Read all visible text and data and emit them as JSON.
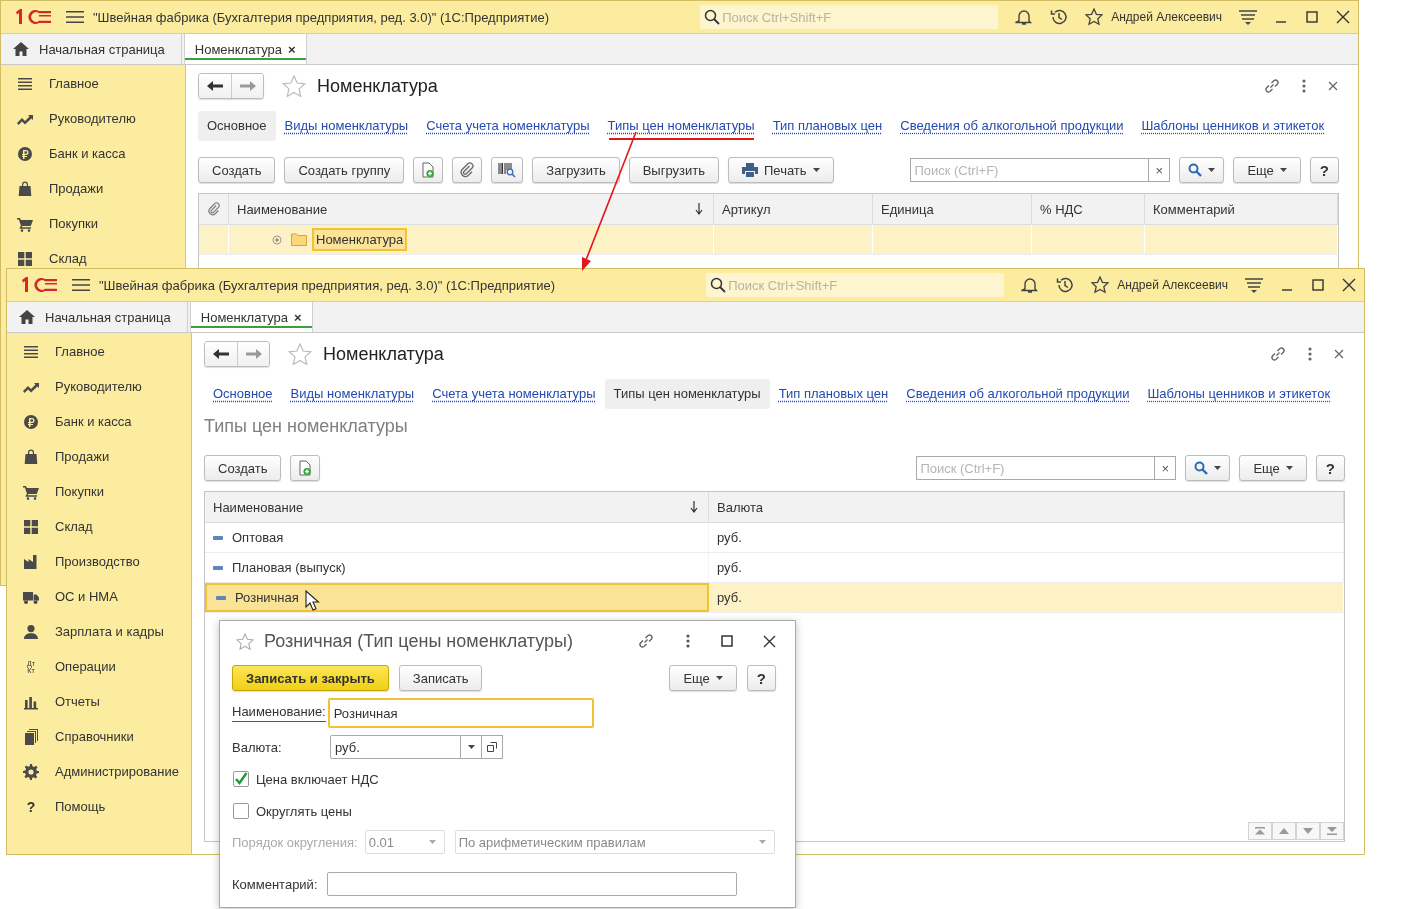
{
  "windows": [
    {
      "title": "\"Швейная фабрика (Бухгалтерия предприятия, ред. 3.0)\"  (1С:Предприятие)",
      "search_placeholder": "Поиск Ctrl+Shift+F",
      "user": "Андрей Алексеевич",
      "tabs": [
        {
          "label": "Начальная страница",
          "selected": false,
          "kind": "home"
        },
        {
          "label": "Номенклатура",
          "selected": true,
          "kind": "page",
          "close": "×"
        }
      ],
      "sidebar": [
        {
          "label": "Главное"
        },
        {
          "label": "Руководителю"
        },
        {
          "label": "Банк и касса"
        },
        {
          "label": "Продажи"
        },
        {
          "label": "Покупки"
        },
        {
          "label": "Склад"
        }
      ],
      "form": {
        "title": "Номенклатура",
        "sections": [
          {
            "label": "Основное",
            "selected": true,
            "annotated": false
          },
          {
            "label": "Виды номенклатуры",
            "selected": false,
            "annotated": false
          },
          {
            "label": "Счета учета номенклатуры",
            "selected": false,
            "annotated": false
          },
          {
            "label": "Типы цен номенклатуры",
            "selected": false,
            "annotated": true
          },
          {
            "label": "Тип плановых цен",
            "selected": false,
            "annotated": false
          },
          {
            "label": "Сведения об алкогольной продукции",
            "selected": false,
            "annotated": false
          },
          {
            "label": "Шаблоны ценников и этикеток",
            "selected": false,
            "annotated": false
          }
        ],
        "toolbar": [
          {
            "kind": "button",
            "label": "Создать"
          },
          {
            "kind": "button",
            "label": "Создать группу"
          },
          {
            "kind": "new"
          },
          {
            "kind": "attach"
          },
          {
            "kind": "barcode"
          },
          {
            "kind": "button",
            "label": "Загрузить"
          },
          {
            "kind": "button",
            "label": "Выгрузить"
          },
          {
            "kind": "print",
            "label": "Печать"
          }
        ],
        "search_placeholder": "Поиск (Ctrl+F)",
        "clear": "×",
        "more": "Еще",
        "help": "?",
        "table": {
          "attach_column": true,
          "columns": [
            {
              "label": "Наименование",
              "sorted": true
            },
            {
              "label": "Артикул",
              "sorted": false
            },
            {
              "label": "Единица",
              "sorted": false
            },
            {
              "label": "% НДС",
              "sorted": false
            },
            {
              "label": "Комментарий",
              "sorted": false
            }
          ],
          "rows": [
            {
              "kind": "folder",
              "selected": true,
              "cells": [
                "Номенклатура"
              ]
            }
          ]
        }
      }
    },
    {
      "title": "\"Швейная фабрика (Бухгалтерия предприятия, ред. 3.0)\"  (1С:Предприятие)",
      "search_placeholder": "Поиск Ctrl+Shift+F",
      "user": "Андрей Алексеевич",
      "tabs": [
        {
          "label": "Начальная страница",
          "selected": false,
          "kind": "home"
        },
        {
          "label": "Номенклатура",
          "selected": true,
          "kind": "page",
          "close": "×"
        }
      ],
      "sidebar": [
        {
          "label": "Главное"
        },
        {
          "label": "Руководителю"
        },
        {
          "label": "Банк и касса"
        },
        {
          "label": "Продажи"
        },
        {
          "label": "Покупки"
        },
        {
          "label": "Склад"
        },
        {
          "label": "Производство"
        },
        {
          "label": "ОС и НМА"
        },
        {
          "label": "Зарплата и кадры"
        },
        {
          "label": "Операции",
          "glyph": [
            "Дт",
            "Кт"
          ]
        },
        {
          "label": "Отчеты"
        },
        {
          "label": "Справочники"
        },
        {
          "label": "Администрирование"
        },
        {
          "label": "Помощь",
          "glyph": [
            "?"
          ]
        }
      ],
      "form": {
        "title": "Номенклатура",
        "section_title": "Типы цен номенклатуры",
        "sections": [
          {
            "label": "Основное",
            "selected": false,
            "annotated": false
          },
          {
            "label": "Виды номенклатуры",
            "selected": false,
            "annotated": false
          },
          {
            "label": "Счета учета номенклатуры",
            "selected": false,
            "annotated": false
          },
          {
            "label": "Типы цен номенклатуры",
            "selected": true,
            "annotated": false
          },
          {
            "label": "Тип плановых цен",
            "selected": false,
            "annotated": false
          },
          {
            "label": "Сведения об алкогольной продукции",
            "selected": false,
            "annotated": false
          },
          {
            "label": "Шаблоны ценников и этикеток",
            "selected": false,
            "annotated": false
          }
        ],
        "toolbar": [
          {
            "kind": "button",
            "label": "Создать"
          },
          {
            "kind": "new"
          }
        ],
        "search_placeholder": "Поиск (Ctrl+F)",
        "clear": "×",
        "more": "Еще",
        "help": "?",
        "table": {
          "attach_column": false,
          "pager": true,
          "columns": [
            {
              "label": "Наименование",
              "sorted": true
            },
            {
              "label": "Валюта",
              "sorted": false
            }
          ],
          "rows": [
            {
              "kind": "item",
              "selected": false,
              "cells": [
                "Оптовая",
                "руб."
              ]
            },
            {
              "kind": "item",
              "selected": false,
              "cells": [
                "Плановая (выпуск)",
                "руб."
              ]
            },
            {
              "kind": "item",
              "selected": true,
              "cells": [
                "Розничная",
                "руб."
              ]
            }
          ]
        }
      }
    }
  ],
  "dialog": {
    "title": "Розничная (Тип цены номенклатуры)",
    "save_close": "Записать и закрыть",
    "save": "Записать",
    "more": "Еще",
    "help": "?",
    "fields": [
      {
        "kind": "text",
        "label": "Наименование:",
        "value": "Розничная",
        "focused": true,
        "annotated": true
      },
      {
        "kind": "select",
        "label": "Валюта:",
        "value": "руб."
      },
      {
        "kind": "checkbox",
        "label": "Цена включает НДС",
        "checked": true
      },
      {
        "kind": "checkbox",
        "label": "Округлять цены",
        "checked": false
      },
      {
        "kind": "rounding",
        "label": "Порядок округления:",
        "value": "0.01",
        "method": "По арифметическим правилам",
        "disabled": true
      },
      {
        "kind": "text",
        "label": "Комментарий:",
        "focused": false,
        "annotated": false
      }
    ]
  }
}
